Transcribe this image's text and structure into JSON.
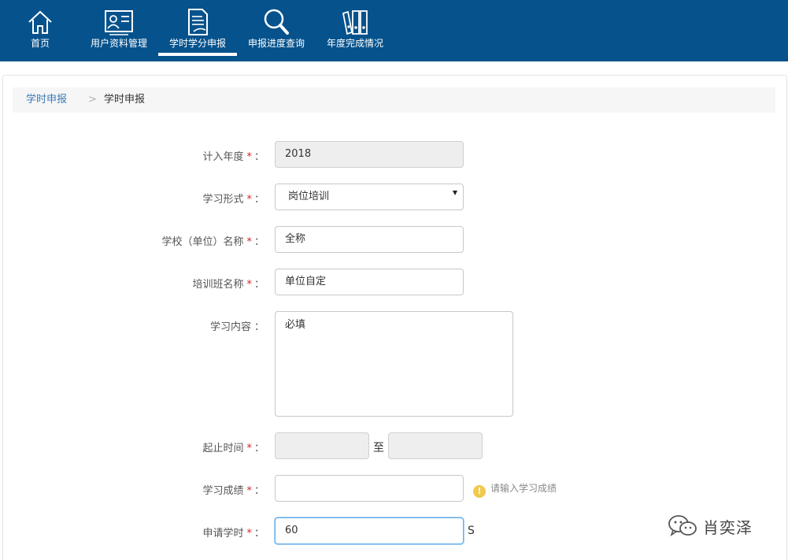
{
  "nav": {
    "items": [
      {
        "label": "首页",
        "icon": "home-icon"
      },
      {
        "label": "用户资料管理",
        "icon": "user-card-icon"
      },
      {
        "label": "学时学分申报",
        "icon": "document-icon",
        "active": true
      },
      {
        "label": "申报进度查询",
        "icon": "search-icon"
      },
      {
        "label": "年度完成情况",
        "icon": "books-icon"
      }
    ]
  },
  "breadcrumb": {
    "link": "学时申报",
    "separator": ">",
    "current": "学时申报"
  },
  "form": {
    "year": {
      "label": "计入年度",
      "value": "2018"
    },
    "study_form": {
      "label": "学习形式",
      "value": "岗位培训"
    },
    "school": {
      "label": "学校（单位）名称",
      "value": "全称"
    },
    "class_name": {
      "label": "培训班名称",
      "value": "单位自定"
    },
    "content": {
      "label": "学习内容",
      "value": "必填"
    },
    "period": {
      "label": "起止时间",
      "start": "",
      "end": "",
      "to": "至"
    },
    "score": {
      "label": "学习成绩",
      "value": "",
      "hint": "请输入学习成绩"
    },
    "hours": {
      "label": "申请学时",
      "value": "60",
      "unit": "S"
    },
    "required_mark": "*",
    "colon": "："
  },
  "watermark": {
    "text": "肖奕泽"
  },
  "colors": {
    "nav_bg": "#05528c",
    "link": "#3d7ab8",
    "required": "#e02020",
    "warning": "#f0c94e"
  }
}
